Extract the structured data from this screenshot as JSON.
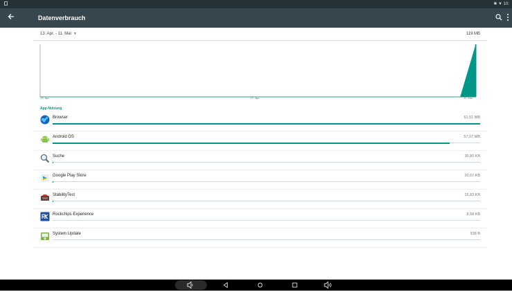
{
  "status_bar": {
    "right_text": "✱ ▼ 10:"
  },
  "app_bar": {
    "title": "Datenverbrauch",
    "back_icon": "arrow-back-icon",
    "search_icon": "search-icon",
    "menu_icon": "more-vert-icon"
  },
  "summary": {
    "date_range": "13. Apr. - 11. Mai",
    "total": "119 MB"
  },
  "chart_data": {
    "type": "area",
    "x_ticks": [
      "13. Apr.",
      "27. Apr.",
      "11. Mai"
    ],
    "description_points": [
      0,
      0,
      0,
      0,
      0,
      0,
      0,
      0,
      0,
      0,
      0,
      0,
      0,
      0,
      0,
      0,
      0,
      0,
      0,
      0,
      0,
      0,
      0,
      0,
      0,
      0,
      0,
      0,
      119
    ],
    "y_unit": "MB",
    "color": "#009688",
    "grid": false
  },
  "section": {
    "title": "App-Nutzung"
  },
  "apps": [
    {
      "name": "Browser",
      "size": "61,51 MB",
      "fraction": 1.0,
      "icon": "browser-globe-icon"
    },
    {
      "name": "Android OS",
      "size": "57,07 MB",
      "fraction": 0.928,
      "icon": "android-icon"
    },
    {
      "name": "Suche",
      "size": "35,80 KB",
      "fraction": 0.0006,
      "icon": "search-magnifier-icon"
    },
    {
      "name": "Google Play Store",
      "size": "20,67 KB",
      "fraction": 0.0003,
      "icon": "play-store-icon"
    },
    {
      "name": "StabilityTest",
      "size": "15,83 KB",
      "fraction": 0.0003,
      "icon": "stability-test-icon"
    },
    {
      "name": "Rockchips Experience",
      "size": "8,58 KB",
      "fraction": 0.0001,
      "icon": "rk-logo-icon"
    },
    {
      "name": "System Update",
      "size": "538 B",
      "fraction": 0.0,
      "icon": "system-update-icon"
    }
  ],
  "nav_bar": {
    "volume_down": "volume-down-icon",
    "back": "nav-back-icon",
    "home": "nav-home-icon",
    "recents": "nav-recents-icon",
    "volume_up": "volume-up-icon"
  }
}
